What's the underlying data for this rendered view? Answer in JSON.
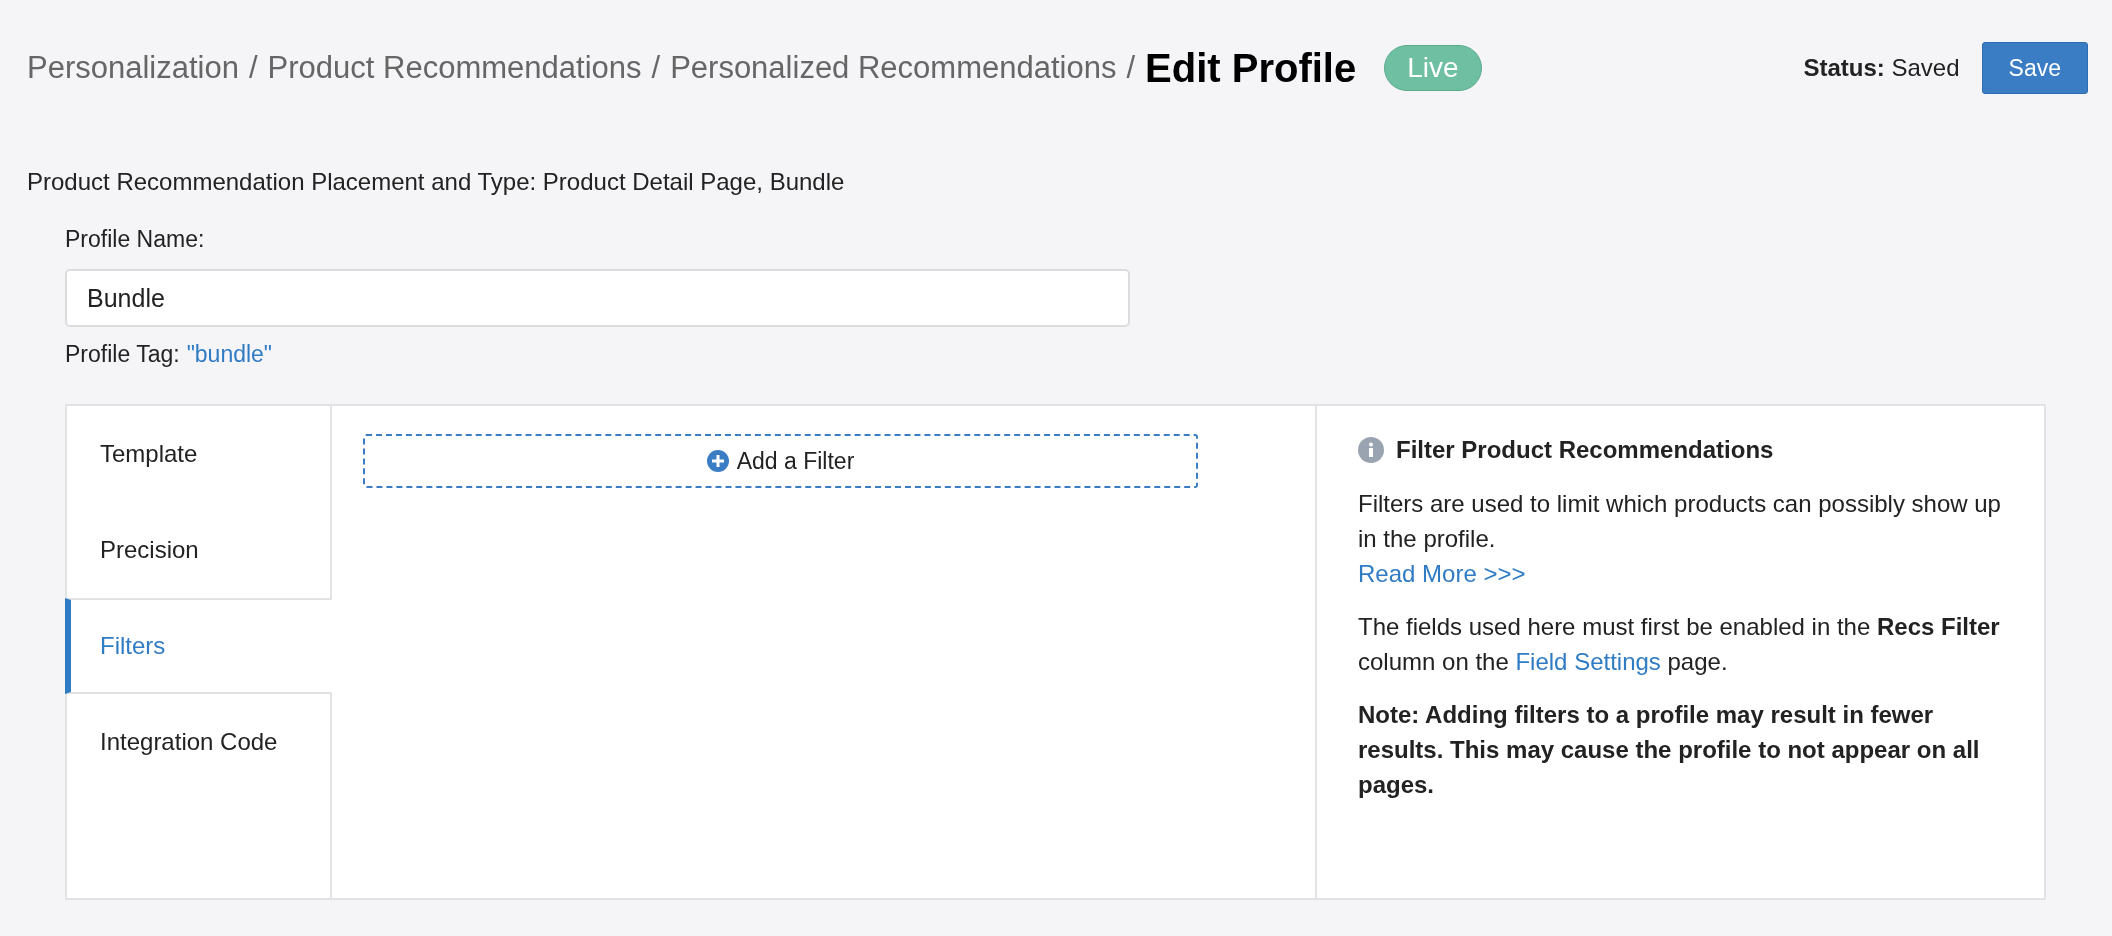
{
  "breadcrumb": {
    "items": [
      "Personalization",
      "Product Recommendations",
      "Personalized Recommendations"
    ],
    "separators": [
      "/",
      "/",
      "/"
    ],
    "current": "Edit Profile"
  },
  "status_badge": "Live",
  "status": "**Status:** Saved",
  "save_button": "Save",
  "placement_line": "Product Recommendation Placement and Type: Product Detail Page, Bundle",
  "profile_name": {
    "label": "Profile Name:",
    "value": "Bundle"
  },
  "profile_tag": {
    "label": "Profile Tag:",
    "value": "\"bundle\""
  },
  "tabs": [
    {
      "label": "Template",
      "selected": false
    },
    {
      "label": "Precision",
      "selected": false
    },
    {
      "label": "Filters",
      "selected": true
    },
    {
      "label": "Integration Code",
      "selected": false
    }
  ],
  "add_filter_button": "Add a Filter",
  "help": {
    "title": "Filter Product Recommendations",
    "intro": "Filters are used to limit which products can possibly show up in the profile.",
    "read_more_link": "Read More >>>",
    "fields_text": {
      "before": "The fields used here must first be enabled in the **Recs Filter** column on the ",
      "link": "Field Settings",
      "after": " page."
    },
    "note": "Note: Adding filters to a profile may result in fewer results. This may cause the profile to not appear on all pages."
  }
}
